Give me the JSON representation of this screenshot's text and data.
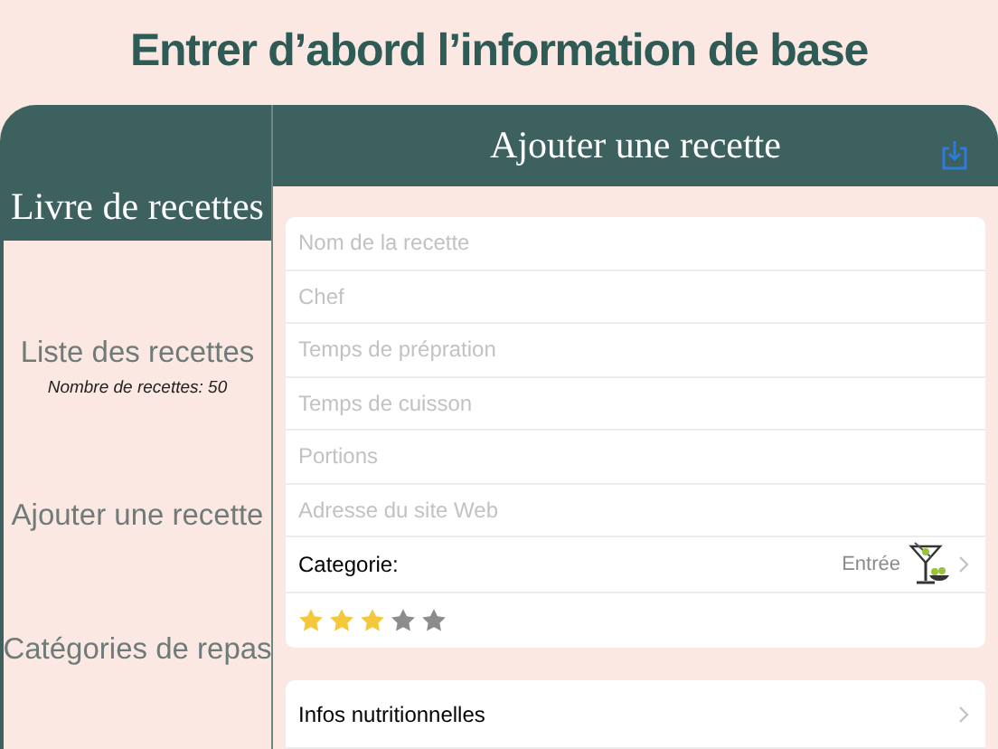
{
  "headline": "Entrer d’abord l’information de base",
  "sidebar": {
    "title": "Livre de recettes",
    "items": [
      {
        "label": "Liste des recettes",
        "subtitle": "Nombre de recettes:  50"
      },
      {
        "label": "Ajouter une recette"
      },
      {
        "label": "Catégories de repas"
      }
    ]
  },
  "header": {
    "title": "Ajouter une recette"
  },
  "fields": [
    {
      "placeholder": "Nom de la recette"
    },
    {
      "placeholder": "Chef"
    },
    {
      "placeholder": "Temps de prépration"
    },
    {
      "placeholder": "Temps de cuisson"
    },
    {
      "placeholder": "Portions"
    },
    {
      "placeholder": "Adresse du site Web"
    }
  ],
  "category": {
    "label": "Categorie:",
    "value": "Entrée"
  },
  "rating": {
    "stars": 3
  },
  "nutrition": {
    "label": "Infos nutritionnelles"
  }
}
